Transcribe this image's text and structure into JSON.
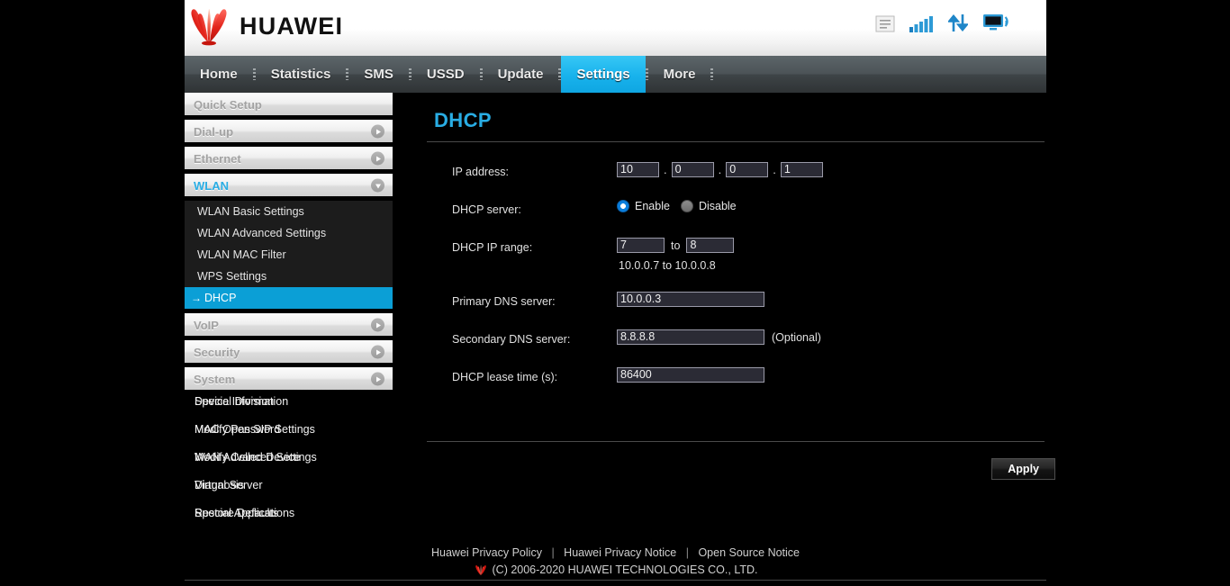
{
  "brand": {
    "name": "HUAWEI",
    "logo_icon": "huawei-flower-logo",
    "accent": "#29ade4",
    "red": "#e2231a"
  },
  "status_icons": [
    {
      "name": "message-icon",
      "state": "inactive"
    },
    {
      "name": "signal-bars-icon",
      "state": "active"
    },
    {
      "name": "data-transfer-icon",
      "state": "active"
    },
    {
      "name": "monitor-wifi-icon",
      "state": "active"
    }
  ],
  "nav": {
    "items": [
      {
        "label": "Home",
        "active": false
      },
      {
        "label": "Statistics",
        "active": false
      },
      {
        "label": "SMS",
        "active": false
      },
      {
        "label": "USSD",
        "active": false
      },
      {
        "label": "Update",
        "active": false
      },
      {
        "label": "Settings",
        "active": true
      },
      {
        "label": "More",
        "active": false
      }
    ]
  },
  "sidebar": {
    "groups": [
      {
        "label": "Quick Setup",
        "expandable": false,
        "expanded": false
      },
      {
        "label": "Dial-up",
        "expandable": true,
        "expanded": false
      },
      {
        "label": "Ethernet",
        "expandable": true,
        "expanded": false
      },
      {
        "label": "WLAN",
        "expandable": true,
        "expanded": true
      },
      {
        "label": "VoIP",
        "expandable": true,
        "expanded": false
      },
      {
        "label": "Security",
        "expandable": true,
        "expanded": false
      },
      {
        "label": "System",
        "expandable": true,
        "expanded": false
      }
    ],
    "wlan_items": [
      {
        "label": "WLAN Basic Settings",
        "selected": false
      },
      {
        "label": "WLAN Advanced Settings",
        "selected": false
      },
      {
        "label": "WLAN MAC Filter",
        "selected": false
      },
      {
        "label": "WPS Settings",
        "selected": false
      },
      {
        "label": "DHCP",
        "selected": true
      }
    ],
    "selected_arrow": "→",
    "overlapped_rows": [
      [
        "Device Information",
        "Special Division"
      ],
      [
        "Modify Password",
        "MAC Open SIP Settings"
      ],
      [
        "WAN Advanced Settings",
        "Modify Celled Device"
      ],
      [
        "Virtual Server",
        "Diagnosis"
      ],
      [
        "Special Applications",
        "Restore Defaults"
      ]
    ]
  },
  "page": {
    "title": "DHCP"
  },
  "form": {
    "ip_address": {
      "label": "IP address:",
      "octets": [
        "10",
        "0",
        "0",
        "1"
      ],
      "separator": "."
    },
    "dhcp_server": {
      "label": "DHCP server:",
      "options": [
        {
          "label": "Enable",
          "selected": true
        },
        {
          "label": "Disable",
          "selected": false
        }
      ]
    },
    "dhcp_ip_range": {
      "label": "DHCP IP range:",
      "start": "7",
      "to_label": "to",
      "end": "8",
      "hint": "10.0.0.7 to 10.0.0.8"
    },
    "primary_dns": {
      "label": "Primary DNS server:",
      "value": "10.0.0.3"
    },
    "secondary_dns": {
      "label": "Secondary DNS server:",
      "value": "8.8.8.8",
      "suffix": "(Optional)"
    },
    "lease_time": {
      "label": "DHCP lease time (s):",
      "value": "86400"
    },
    "apply_label": "Apply"
  },
  "footer": {
    "links": [
      "Huawei Privacy Policy",
      "Huawei Privacy Notice",
      "Open Source Notice"
    ],
    "separator": "|",
    "copyright": "(C) 2006-2020 HUAWEI TECHNOLOGIES CO., LTD."
  }
}
